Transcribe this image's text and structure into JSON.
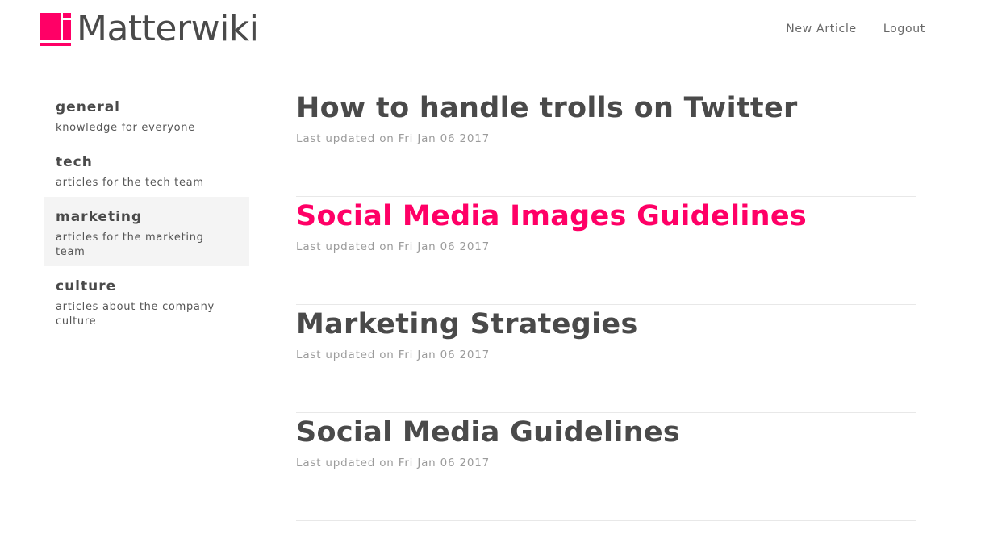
{
  "brand": {
    "name": "Matterwiki",
    "accent_color": "#ff0066",
    "logo_icon": "matterwiki-logo-icon"
  },
  "nav": {
    "new_article": "New Article",
    "logout": "Logout"
  },
  "sidebar": {
    "topics": [
      {
        "name": "general",
        "description": "knowledge for everyone",
        "active": false
      },
      {
        "name": "tech",
        "description": "articles for the tech team",
        "active": false
      },
      {
        "name": "marketing",
        "description": "articles for the marketing team",
        "active": true
      },
      {
        "name": "culture",
        "description": "articles about the company culture",
        "active": false
      }
    ]
  },
  "articles": [
    {
      "title": "How to handle trolls on Twitter",
      "updated": "Last updated on Fri Jan 06 2017",
      "highlighted": false
    },
    {
      "title": "Social Media Images Guidelines",
      "updated": "Last updated on Fri Jan 06 2017",
      "highlighted": true
    },
    {
      "title": "Marketing Strategies",
      "updated": "Last updated on Fri Jan 06 2017",
      "highlighted": false
    },
    {
      "title": "Social Media Guidelines",
      "updated": "Last updated on Fri Jan 06 2017",
      "highlighted": false
    }
  ]
}
